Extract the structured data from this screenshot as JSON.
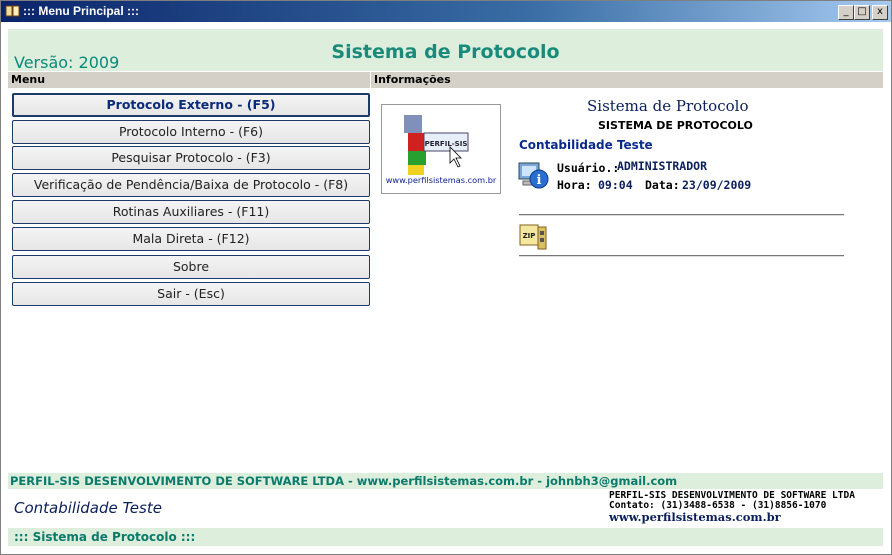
{
  "window": {
    "title": "::: Menu Principal :::",
    "controls": {
      "minimize": "_",
      "maximize": "□",
      "close": "x"
    }
  },
  "header": {
    "version": "Versão: 2009",
    "title": "Sistema de Protocolo"
  },
  "sections": {
    "menu": "Menu",
    "info": "Informações"
  },
  "menu": [
    {
      "label": "Protocolo Externo  - (F5)",
      "active": true
    },
    {
      "label": "Protocolo Interno  - (F6)"
    },
    {
      "label": "Pesquisar Protocolo - (F3)"
    },
    {
      "label": "Verificação de Pendência/Baixa de Protocolo - (F8)"
    },
    {
      "label": "Rotinas Auxiliares - (F11)"
    },
    {
      "label": "Mala Direta - (F12)"
    },
    {
      "label": "Sobre"
    },
    {
      "label": "Sair - (Esc)"
    }
  ],
  "logo": {
    "brand": "PERFIL-SIS",
    "url": "www.perfilsistemas.com.br"
  },
  "info": {
    "title": "Sistema de Protocolo",
    "subtitle": "SISTEMA DE PROTOCOLO",
    "company": "Contabilidade Teste",
    "user_label": "Usuário.:",
    "user_value": "ADMINISTRADOR",
    "hora_label": "Hora:",
    "hora_value": "09:04",
    "data_label": "Data:",
    "data_value": "23/09/2009",
    "zip_label": "ZIP"
  },
  "footer": {
    "line1": "PERFIL-SIS DESENVOLVIMENTO DE SOFTWARE LTDA - www.perfilsistemas.com.br - johnbh3@gmail.com",
    "company": "Contabilidade Teste",
    "right_name": "PERFIL-SIS DESENVOLVIMENTO DE SOFTWARE LTDA",
    "right_contact": "Contato: (31)3488-6538 - (31)8856-1070",
    "right_url": "www.perfilsistemas.com.br",
    "status": "::: Sistema de Protocolo :::"
  },
  "colors": {
    "accent": "#1a8a7a",
    "navy": "#0b1f5a",
    "panel": "#ddeedd"
  }
}
